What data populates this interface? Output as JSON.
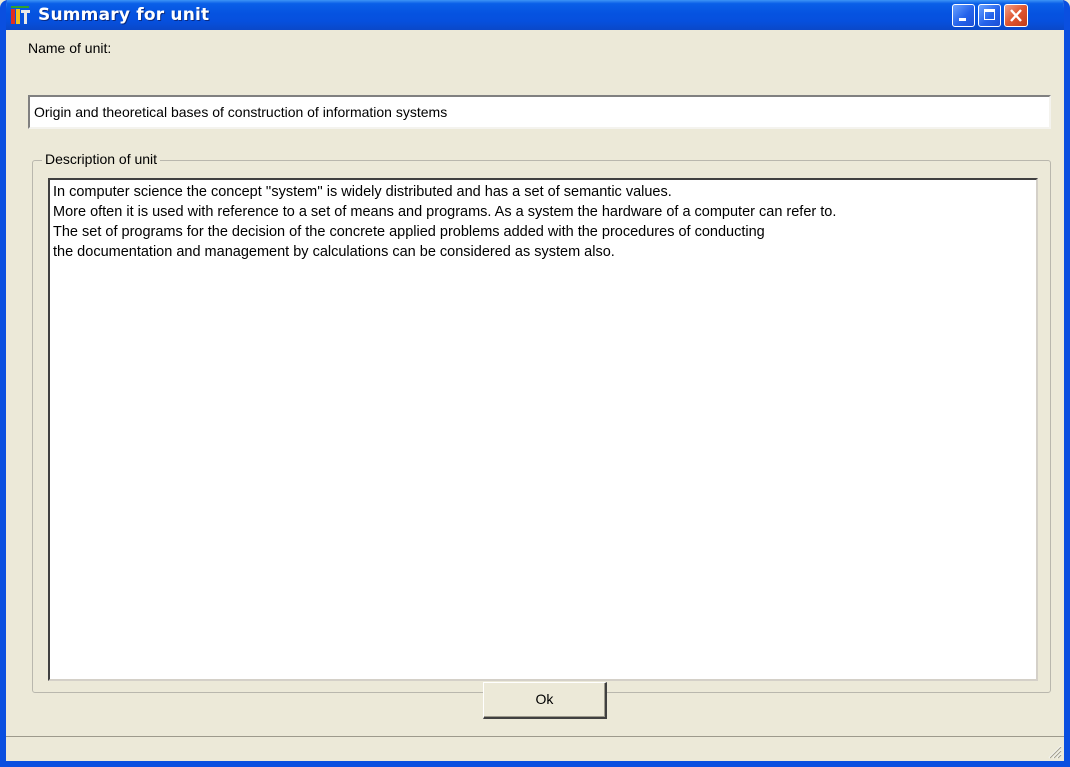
{
  "window": {
    "title": "Summary for unit"
  },
  "name_section": {
    "label": "Name of unit:",
    "value": "Origin and theoretical bases of construction of information systems"
  },
  "description_section": {
    "label": "Description of unit",
    "lines": [
      "In computer science the concept ''system'' is widely distributed and has a set  of semantic values.",
      "More often it is used with reference to a set of means and programs. As a system the hardware of a computer can refer to.",
      "The set of programs for the decision of the concrete applied problems  added with the procedures of conducting",
      "the documentation and management by calculations can be considered as system also."
    ]
  },
  "buttons": {
    "ok_label": "Ok"
  },
  "icons": {
    "app": "app-logo-icon",
    "minimize": "minimize-icon",
    "maximize": "maximize-icon",
    "close": "close-icon",
    "grip": "resize-grip-icon"
  },
  "colors": {
    "titlebar": "#0553e0",
    "window_face": "#ece9d8",
    "close_button": "#e0552e"
  }
}
